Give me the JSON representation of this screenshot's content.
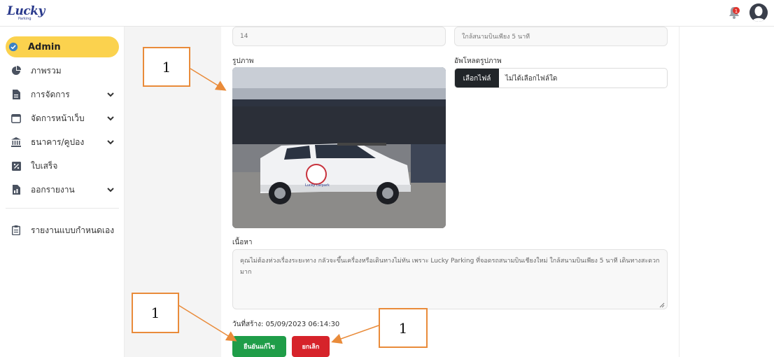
{
  "header": {
    "logo_text": "Lucky",
    "logo_sub": "Parking",
    "notification_icon": "bell-icon",
    "notification_color": "#e0322c",
    "avatar_icon": "user-avatar-icon"
  },
  "sidebar": {
    "items": [
      {
        "label": "Admin",
        "icon": "check-circle-icon",
        "active": true,
        "has_chevron": false
      },
      {
        "label": "ภาพรวม",
        "icon": "pie-chart-icon",
        "active": false,
        "has_chevron": false
      },
      {
        "label": "การจัดการ",
        "icon": "document-icon",
        "active": false,
        "has_chevron": true
      },
      {
        "label": "จัดการหน้าเว็บ",
        "icon": "browser-window-icon",
        "active": false,
        "has_chevron": true
      },
      {
        "label": "ธนาคาร/คูปอง",
        "icon": "bank-icon",
        "active": false,
        "has_chevron": true
      },
      {
        "label": "ใบเสร็จ",
        "icon": "receipt-icon",
        "active": false,
        "has_chevron": false
      },
      {
        "label": "ออกรายงาน",
        "icon": "report-icon",
        "active": false,
        "has_chevron": true
      },
      {
        "label": "รายงานแบบกำหนดเอง",
        "icon": "clipboard-icon",
        "active": false,
        "has_chevron": false
      }
    ]
  },
  "form": {
    "top_left_value": "14",
    "top_right_value": "ใกล้สนามบินเพียง 5 นาที",
    "image_label": "รูปภาพ",
    "upload_label": "อัพโหลดรูปภาพ",
    "choose_file_label": "เลือกไฟล์",
    "no_file_label": "ไม่ได้เลือกไฟล์ใด",
    "photo_sign_text": "Lucky carpark",
    "content_label": "เนื้อหา",
    "content_text": "คุณไม่ต้องห่วงเรื่องระยะทาง กลัวจะขึ้นเครื่องหรือเดินทางไม่ทัน เพราะ Lucky Parking ที่จอดรถสนามบินเชียงใหม่ ใกล้สนามบินเพียง 5 นาที เดินทางสะดวกมาก",
    "created_label": "วันที่สร้าง: 05/09/2023 06:14:30",
    "save_label": "ยืนยันแก้ไข",
    "cancel_label": "ยกเลิก"
  },
  "annotations": {
    "callout_1": "1",
    "callout_2": "1",
    "callout_3": "1",
    "callout_color": "#e98b3a"
  }
}
